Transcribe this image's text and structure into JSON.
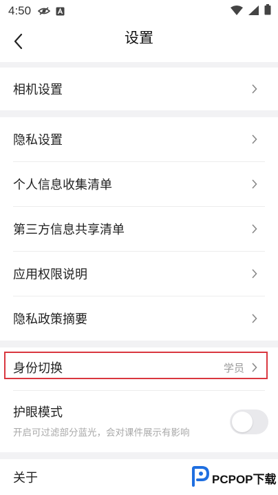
{
  "status_bar": {
    "time": "4:50"
  },
  "header": {
    "title": "设置"
  },
  "group1": [
    {
      "label": "相机设置"
    }
  ],
  "group2": [
    {
      "label": "隐私设置"
    },
    {
      "label": "个人信息收集清单"
    },
    {
      "label": "第三方信息共享清单"
    },
    {
      "label": "应用权限说明"
    },
    {
      "label": "隐私政策摘要"
    }
  ],
  "identity": {
    "label": "身份切换",
    "value": "学员"
  },
  "eye_mode": {
    "label": "护眼模式",
    "description": "开启可过滤部分蓝光，会对课件展示有影响",
    "enabled": false
  },
  "about": {
    "label": "关于"
  },
  "watermark": {
    "brand": "PCPOP下载"
  },
  "colors": {
    "highlight_border": "#d9363e",
    "band": "#f2f2f4",
    "toggle_off": "#e9e9ec"
  }
}
